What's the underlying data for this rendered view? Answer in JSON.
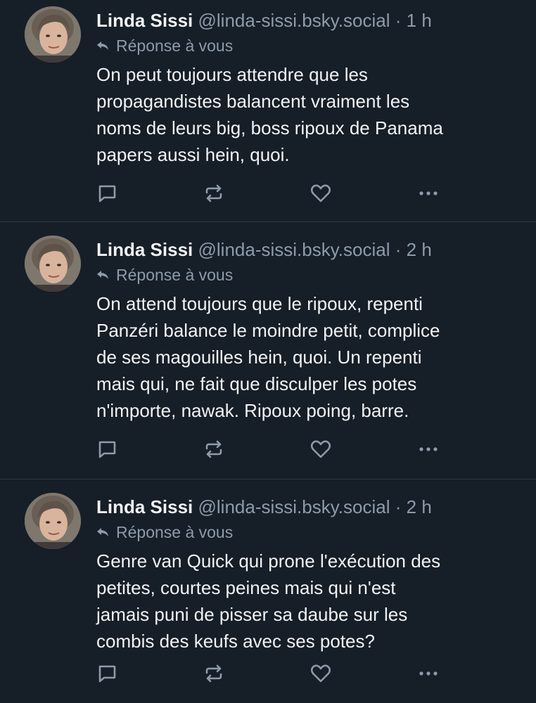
{
  "theme": {
    "background": "#161e27",
    "text_primary": "#f1f3f5",
    "text_secondary": "#8d9bab",
    "divider": "#2e3a48"
  },
  "posts": [
    {
      "author": "Linda Sissi",
      "handle": "@linda-sissi.bsky.social",
      "separator": "·",
      "time": "1 h",
      "reply_label": "Réponse à vous",
      "text": "On peut toujours attendre que les\npropagandistes balancent vraiment les\nnoms de leurs big, boss ripoux de Panama\npapers aussi hein, quoi.",
      "icons": {
        "reply": "reply-icon",
        "comment": "comment-icon",
        "repost": "repost-icon",
        "like": "heart-icon",
        "more": "more-options-icon"
      }
    },
    {
      "author": "Linda Sissi",
      "handle": "@linda-sissi.bsky.social",
      "separator": "·",
      "time": "2 h",
      "reply_label": "Réponse à vous",
      "text": "On attend toujours que le ripoux, repenti\nPanzéri balance le moindre petit, complice\nde ses magouilles hein, quoi. Un repenti\nmais qui, ne fait que disculper les potes\nn'importe, nawak. Ripoux poing, barre.",
      "icons": {
        "reply": "reply-icon",
        "comment": "comment-icon",
        "repost": "repost-icon",
        "like": "heart-icon",
        "more": "more-options-icon"
      }
    },
    {
      "author": "Linda Sissi",
      "handle": "@linda-sissi.bsky.social",
      "separator": "·",
      "time": "2 h",
      "reply_label": "Réponse à vous",
      "text": "Genre van Quick qui prone l'exécution des\npetites, courtes peines mais qui n'est\njamais puni de pisser sa daube sur les\ncombis des keufs avec ses potes?",
      "icons": {
        "reply": "reply-icon",
        "comment": "comment-icon",
        "repost": "repost-icon",
        "like": "heart-icon",
        "more": "more-options-icon"
      }
    }
  ]
}
